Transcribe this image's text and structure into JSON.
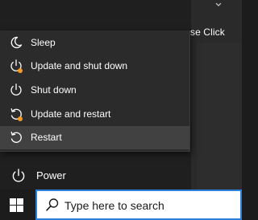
{
  "background": {
    "partial_text": "se Click"
  },
  "power_menu": {
    "items": [
      {
        "label": "Sleep",
        "icon": "moon-icon",
        "update_badge": false,
        "hover": false
      },
      {
        "label": "Update and shut down",
        "icon": "power-icon",
        "update_badge": true,
        "hover": false
      },
      {
        "label": "Shut down",
        "icon": "power-icon",
        "update_badge": false,
        "hover": false
      },
      {
        "label": "Update and restart",
        "icon": "restart-icon",
        "update_badge": true,
        "hover": false
      },
      {
        "label": "Restart",
        "icon": "restart-icon",
        "update_badge": false,
        "hover": true
      }
    ]
  },
  "start_menu": {
    "power_label": "Power"
  },
  "taskbar": {
    "search_placeholder": "Type here to search"
  },
  "colors": {
    "accent": "#2b7fd9",
    "update_badge": "#f59a23",
    "menu_bg": "#2b2b2b",
    "hover_bg": "#414141"
  }
}
